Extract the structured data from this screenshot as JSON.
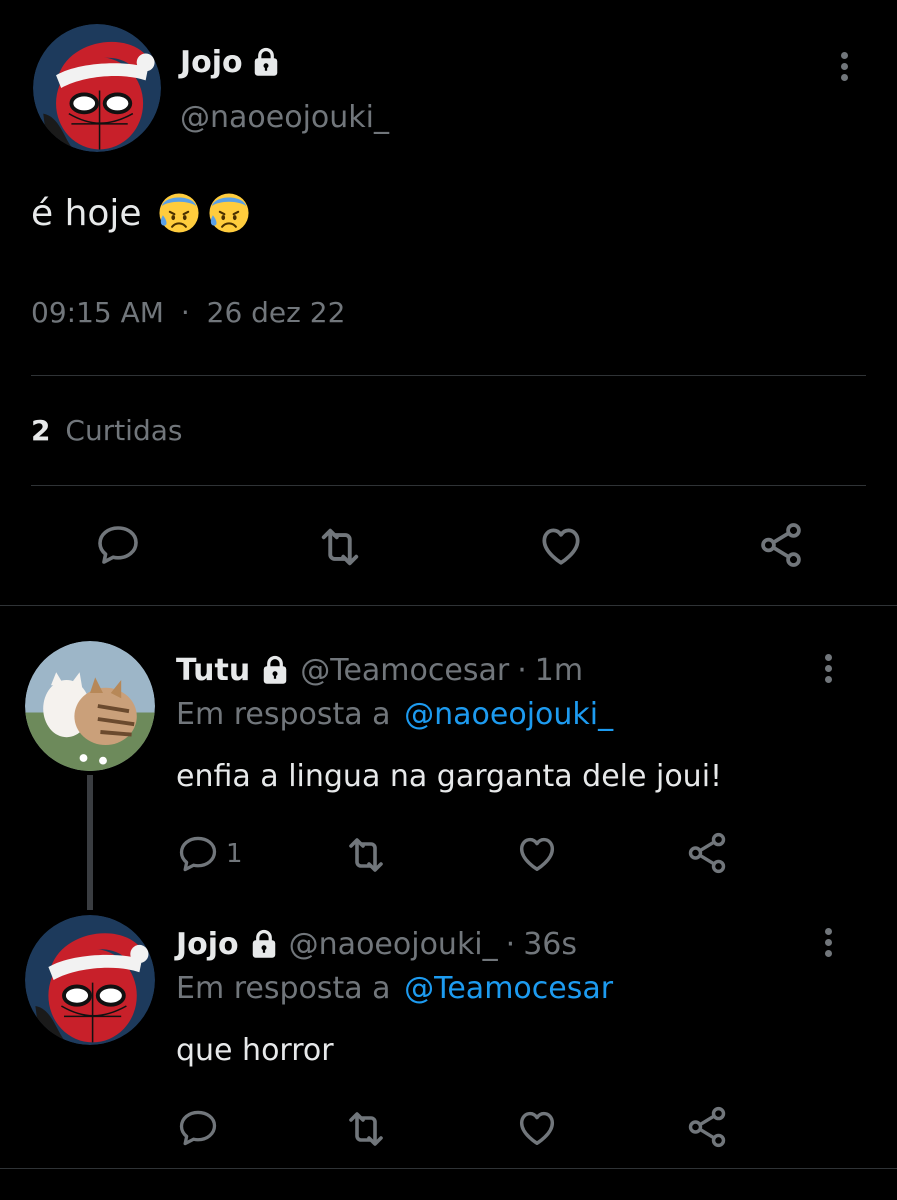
{
  "main_tweet": {
    "author_name": "Jojo",
    "author_handle": "@naoeojouki_",
    "text": "é hoje",
    "emoji": [
      "cold-sweat-face",
      "cold-sweat-face"
    ],
    "time": "09:15 AM",
    "separator": "·",
    "date": "26 dez 22",
    "likes_count": "2",
    "likes_label": "Curtidas",
    "actions": [
      "reply-icon",
      "retweet-icon",
      "like-icon",
      "share-icon"
    ]
  },
  "replies": [
    {
      "author_name": "Tutu",
      "author_handle": "@Teamocesar",
      "separator": "·",
      "age": "1m",
      "reply_to_label": "Em resposta a",
      "reply_to_handle": "@naoeojouki_",
      "text": "enfia a lingua na garganta dele joui!",
      "reply_count": "1"
    },
    {
      "author_name": "Jojo",
      "author_handle": "@naoeojouki_",
      "separator": "·",
      "age": "36s",
      "reply_to_label": "Em resposta a",
      "reply_to_handle": "@Teamocesar",
      "text": "que horror",
      "reply_count": ""
    }
  ],
  "colors": {
    "background": "#000000",
    "text": "#e7e9ea",
    "muted": "#71767b",
    "link": "#1d9bf0",
    "divider": "#2f3336"
  }
}
